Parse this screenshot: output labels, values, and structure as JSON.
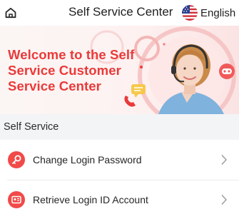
{
  "header": {
    "title": "Self Service Center",
    "language": "English",
    "icons": {
      "home": "home-icon",
      "flag": "us-flag-icon"
    }
  },
  "banner": {
    "headline": "Welcome to the Self Service Customer Service Center",
    "accent_color": "#ea3a3a"
  },
  "section": {
    "title": "Self Service",
    "items": [
      {
        "label": "Change Login Password",
        "icon": "key-icon"
      },
      {
        "label": "Retrieve Login ID Account",
        "icon": "id-card-icon"
      }
    ]
  },
  "colors": {
    "brand_red": "#f24949",
    "page_bg": "#f3f4f6"
  }
}
